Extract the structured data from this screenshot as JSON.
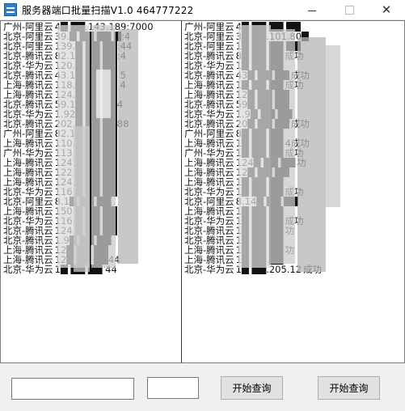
{
  "window": {
    "title": "服务器端口批量扫描V1.0   464777222",
    "controls": {
      "minimize": "",
      "maximize": "",
      "close": "✕"
    }
  },
  "left_list": {
    "rows": [
      {
        "vendor": "广州-阿里云",
        "addr": "4█ ██.143.189:7000",
        "res": ""
      },
      {
        "vendor": "北京-阿里云",
        "addr": "39.█ ██ ██ █:4",
        "res": ""
      },
      {
        "vendor": "北京-阿里云",
        "addr": "139.█ ██ ██:44",
        "res": ""
      },
      {
        "vendor": "北京-腾讯云",
        "addr": "82.1█ ██ ██:4",
        "res": ""
      },
      {
        "vendor": "北京-华为云",
        "addr": "120.█ ██ ██",
        "res": ""
      },
      {
        "vendor": "北京-腾讯云",
        "addr": "43.1█ ██ ██ 5",
        "res": ""
      },
      {
        "vendor": "上海-腾讯云",
        "addr": "118.█ ██ ██ 4",
        "res": ""
      },
      {
        "vendor": "上海-腾讯云",
        "addr": "124.█ ██ ██",
        "res": ""
      },
      {
        "vendor": "北京-腾讯云",
        "addr": "59.1█ ██ ██4",
        "res": ""
      },
      {
        "vendor": "北京-华为云",
        "addr": "1.92█ ██ ██",
        "res": ""
      },
      {
        "vendor": "北京-腾讯云",
        "addr": "202.█ ██ ██88",
        "res": ""
      },
      {
        "vendor": "广州-阿里云",
        "addr": "82.1█ ██ ██",
        "res": ""
      },
      {
        "vendor": "上海-腾讯云",
        "addr": "110.█ ██ ██",
        "res": ""
      },
      {
        "vendor": "广州-华为云",
        "addr": "113.█ ██ ██",
        "res": ""
      },
      {
        "vendor": "上海-腾讯云",
        "addr": "124.█ ██ ██",
        "res": ""
      },
      {
        "vendor": "上海-腾讯云",
        "addr": "122.█ ██ ██",
        "res": ""
      },
      {
        "vendor": "上海-腾讯云",
        "addr": "124.█ ██ ██",
        "res": ""
      },
      {
        "vendor": "北京-华为云",
        "addr": "116.█ ██ ██",
        "res": ""
      },
      {
        "vendor": "北京-阿里云",
        "addr": "8.1█ ██ ██",
        "res": ""
      },
      {
        "vendor": "上海-腾讯云",
        "addr": "150.█ ██ ██",
        "res": ""
      },
      {
        "vendor": "北京-华为云",
        "addr": "116.█ ██ ██",
        "res": ""
      },
      {
        "vendor": "北京-腾讯云",
        "addr": "124.█ ██ ██",
        "res": ""
      },
      {
        "vendor": "北京-腾讯云",
        "addr": "1.9█ ██ ██",
        "res": ""
      },
      {
        "vendor": "上海-腾讯云",
        "addr": "12█ ██ ██",
        "res": ""
      },
      {
        "vendor": "上海-腾讯云",
        "addr": "12█ ██ ██44",
        "res": ""
      },
      {
        "vendor": "北京-华为云",
        "addr": "1█ ██ ██ 44",
        "res": ""
      }
    ]
  },
  "right_list": {
    "rows": [
      {
        "vendor": "广州-阿里云",
        "addr": "4█ ██ ██ ██",
        "res": ""
      },
      {
        "vendor": "北京-阿里云",
        "addr": "3█ ██.101.80█",
        "res": ""
      },
      {
        "vendor": "北京-阿里云",
        "addr": "1█ ██ ██ ██",
        "res": ""
      },
      {
        "vendor": "北京-腾讯云",
        "addr": "8█ ██ ██",
        "res": "成功"
      },
      {
        "vendor": "北京-华为云",
        "addr": "1█ ██ ██",
        "res": ""
      },
      {
        "vendor": "北京-腾讯云",
        "addr": "43█ ██ ██",
        "res": "成功"
      },
      {
        "vendor": "上海-腾讯云",
        "addr": "1█ ██ ██",
        "res": "成功"
      },
      {
        "vendor": "上海-腾讯云",
        "addr": "12█ ██ ██",
        "res": ""
      },
      {
        "vendor": "北京-腾讯云",
        "addr": "59█ ██ ██",
        "res": ""
      },
      {
        "vendor": "北京-华为云",
        "addr": "1.9█ ██ ██",
        "res": ""
      },
      {
        "vendor": "北京-腾讯云",
        "addr": "20█ ██ ██",
        "res": "成功"
      },
      {
        "vendor": "广州-阿里云",
        "addr": "8█ ██ ██",
        "res": ""
      },
      {
        "vendor": "上海-腾讯云",
        "addr": "1█ ██ ██",
        "res": "4成功"
      },
      {
        "vendor": "广州-华为云",
        "addr": "1█ ██ ██",
        "res": "成功"
      },
      {
        "vendor": "上海-腾讯云",
        "addr": "124█ ██ ██",
        "res": "功"
      },
      {
        "vendor": "上海-腾讯云",
        "addr": "12█ ██ ██",
        "res": ""
      },
      {
        "vendor": "上海-腾讯云",
        "addr": "1█ ██ ██",
        "res": ""
      },
      {
        "vendor": "北京-华为云",
        "addr": "1█ ██ ██",
        "res": "成功"
      },
      {
        "vendor": "北京-阿里云",
        "addr": "8.14█ ██ ██",
        "res": ""
      },
      {
        "vendor": "上海-腾讯云",
        "addr": "1█ ██ ██",
        "res": ""
      },
      {
        "vendor": "北京-华为云",
        "addr": "1█ ██ ██",
        "res": "成功"
      },
      {
        "vendor": "北京-腾讯云",
        "addr": "1█ ██ ██",
        "res": "功"
      },
      {
        "vendor": "北京-腾讯云",
        "addr": "1█ ██ ██",
        "res": ""
      },
      {
        "vendor": "上海-腾讯云",
        "addr": "1█ ██ ██",
        "res": "功"
      },
      {
        "vendor": "上海-腾讯云",
        "addr": "1█ ██ ██",
        "res": ""
      },
      {
        "vendor": "北京-华为云",
        "addr": "1█ ██.205.12",
        "res": "成功"
      }
    ]
  },
  "bottom": {
    "input1_value": "",
    "input2_value": "",
    "query_button1": "开始查询",
    "query_button2": "开始查询"
  }
}
